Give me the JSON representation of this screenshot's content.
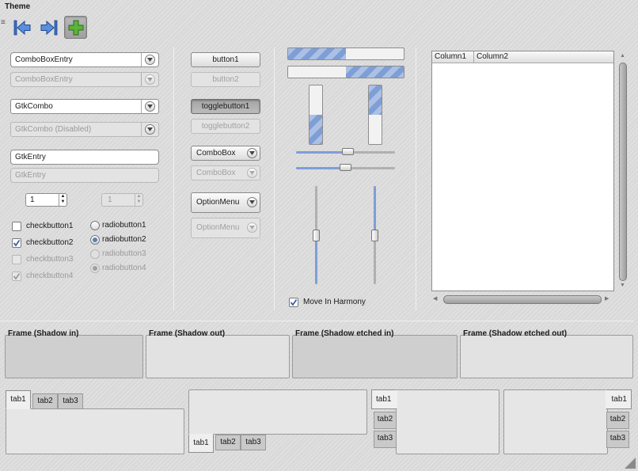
{
  "window": {
    "title": "Theme"
  },
  "toolbar": {
    "back": "go-first-icon",
    "forward": "go-last-icon",
    "add": "add-icon"
  },
  "col1": {
    "combobox_entry": "ComboBoxEntry",
    "combobox_entry_disabled": "ComboBoxEntry",
    "gtkcombo": "GtkCombo",
    "gtkcombo_disabled": "GtkCombo (Disabled)",
    "entry": "GtkEntry",
    "entry_disabled": "GtkEntry",
    "spin_value": "1",
    "spin_disabled_value": "1",
    "checks": [
      {
        "label": "checkbutton1",
        "checked": false,
        "disabled": false
      },
      {
        "label": "checkbutton2",
        "checked": true,
        "disabled": false
      },
      {
        "label": "checkbutton3",
        "checked": false,
        "disabled": true
      },
      {
        "label": "checkbutton4",
        "checked": true,
        "disabled": true
      }
    ],
    "radios": [
      {
        "label": "radiobutton1",
        "selected": false,
        "disabled": false
      },
      {
        "label": "radiobutton2",
        "selected": true,
        "disabled": false
      },
      {
        "label": "radiobutton3",
        "selected": false,
        "disabled": true
      },
      {
        "label": "radiobutton4",
        "selected": true,
        "disabled": true
      }
    ]
  },
  "col2": {
    "button1": "button1",
    "button2": "button2",
    "toggle1": "togglebutton1",
    "toggle2": "togglebutton2",
    "combobox": "ComboBox",
    "combobox_disabled": "ComboBox",
    "optionmenu": "OptionMenu",
    "optionmenu_disabled": "OptionMenu"
  },
  "col3": {
    "progress": [
      0.5,
      0.5,
      0.5,
      0.5
    ],
    "hscale": [
      0.53,
      0.5
    ],
    "vscale": [
      0.5,
      0.5
    ],
    "harmony_label": "Move In Harmony",
    "harmony_checked": true
  },
  "tree": {
    "columns": [
      "Column1",
      "Column2"
    ]
  },
  "frames": [
    {
      "label": "Frame (Shadow in)",
      "style": "in"
    },
    {
      "label": "Frame (Shadow out)",
      "style": "out"
    },
    {
      "label": "Frame (Shadow etched in)",
      "style": "in"
    },
    {
      "label": "Frame (Shadow etched out)",
      "style": "out"
    }
  ],
  "notebooks": {
    "tabs": [
      "tab1",
      "tab2",
      "tab3"
    ],
    "active": "tab1"
  },
  "colors": {
    "accent": "#7e9ed6",
    "background": "#d9d9d9"
  }
}
